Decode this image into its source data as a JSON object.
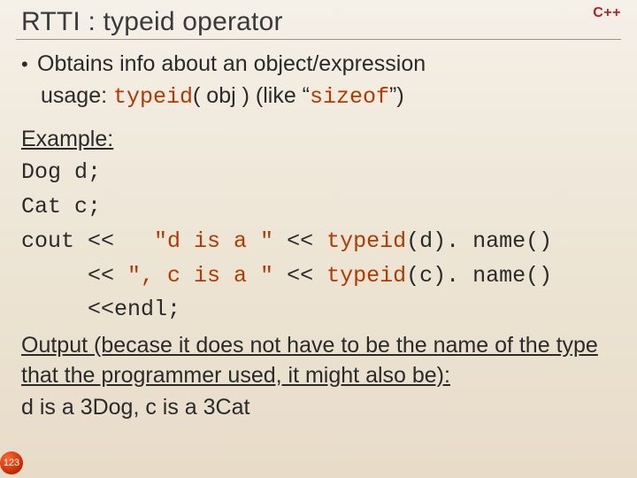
{
  "cpp_label": "C++",
  "title": "RTTI : typeid operator",
  "bullet": "Obtains info about an object/expression",
  "usage_prefix": "usage: ",
  "usage_kw": "typeid",
  "usage_mid": "( obj )    (like “",
  "usage_kw2": "sizeof",
  "usage_suffix": "”)",
  "example_label": "Example:",
  "code": {
    "l1a": "Dog d;",
    "l2a": "Cat c;",
    "l3a": "cout <<   ",
    "l3b": "\"d is a \"",
    "l3c": " << ",
    "l3d": "typeid",
    "l3e": "(d). name()",
    "l4a": "     << ",
    "l4b": "\", c is a \"",
    "l4c": " << ",
    "l4d": "typeid",
    "l4e": "(c). name()",
    "l5a": "     <<endl;"
  },
  "output_label": "Output (becase it does not have to be the name of the type that the programmer used, it might also be):",
  "output_text": "d is a 3Dog, c is a 3Cat",
  "slide_number": "123"
}
